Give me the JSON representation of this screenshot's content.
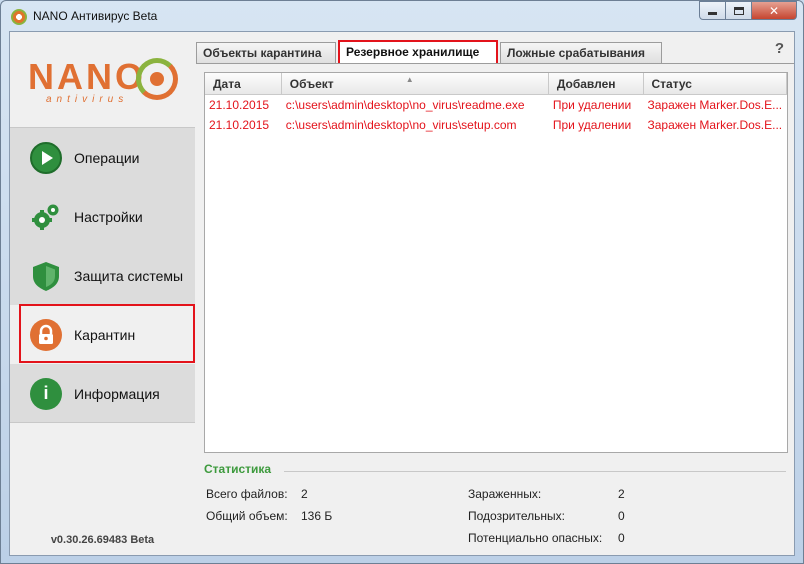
{
  "window": {
    "title": "NANO Антивирус Beta"
  },
  "logo": {
    "brand": "NANO",
    "sub": "antivirus"
  },
  "sidebar": {
    "items": [
      {
        "label": "Операции",
        "icon": "play-icon"
      },
      {
        "label": "Настройки",
        "icon": "gear-icon"
      },
      {
        "label": "Защита системы",
        "icon": "shield-icon"
      },
      {
        "label": "Карантин",
        "icon": "lock-icon"
      },
      {
        "label": "Информация",
        "icon": "info-icon"
      }
    ],
    "version": "v0.30.26.69483 Beta"
  },
  "tabs": [
    {
      "label": "Объекты карантина"
    },
    {
      "label": "Резервное хранилище"
    },
    {
      "label": "Ложные срабатывания"
    }
  ],
  "help": "?",
  "table": {
    "columns": [
      "Дата",
      "Объект",
      "Добавлен",
      "Статус"
    ],
    "rows": [
      {
        "date": "21.10.2015",
        "object": "c:\\users\\admin\\desktop\\no_virus\\readme.exe",
        "added": "При удалении",
        "status": "Заражен Marker.Dos.E..."
      },
      {
        "date": "21.10.2015",
        "object": "c:\\users\\admin\\desktop\\no_virus\\setup.com",
        "added": "При удалении",
        "status": "Заражен Marker.Dos.E..."
      }
    ]
  },
  "stats": {
    "title": "Статистика",
    "total_files_label": "Всего файлов:",
    "total_files": "2",
    "total_size_label": "Общий объем:",
    "total_size": "136 Б",
    "infected_label": "Зараженных:",
    "infected": "2",
    "suspicious_label": "Подозрительных:",
    "suspicious": "0",
    "potential_label": "Потенциально опасных:",
    "potential": "0"
  },
  "colors": {
    "accent": "#e07033",
    "green": "#2f8f3e",
    "red": "#e3131b"
  }
}
